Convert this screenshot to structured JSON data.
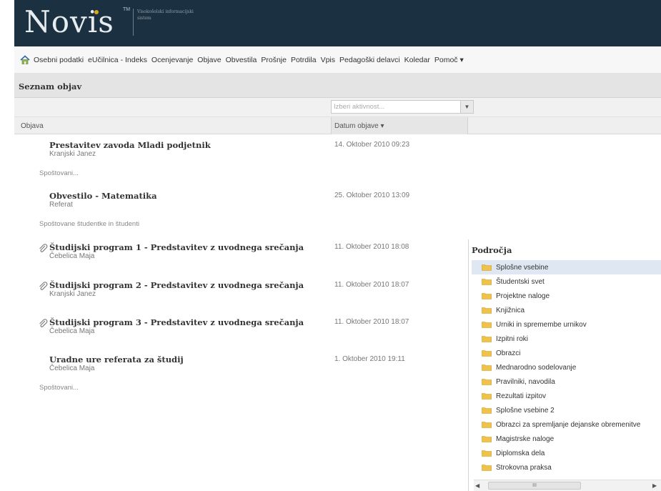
{
  "header": {
    "logo": "Novis",
    "tm": "TM",
    "subtitle": "Visokošolski informacijski sistem"
  },
  "nav": {
    "items": [
      "Osebni podatki",
      "eUčilnica - Indeks",
      "Ocenjevanje",
      "Objave",
      "Obvestila",
      "Prošnje",
      "Potrdila",
      "Vpis",
      "Pedagoški delavci",
      "Koledar",
      "Pomoč ▾"
    ]
  },
  "panel": {
    "title": "Seznam objav"
  },
  "filter": {
    "placeholder": "Izberi aktivnost..."
  },
  "grid": {
    "columns": {
      "objava": "Objava",
      "datum": "Datum objave ▾"
    },
    "rows": [
      {
        "title": "Prestavitev zavoda Mladi podjetnik",
        "author": "Kranjski Janez",
        "date": "14. Oktober 2010 09:23",
        "recipients": "Spoštovani...",
        "attachment": false
      },
      {
        "title": "Obvestilo - Matematika",
        "author": "Referat",
        "date": "25. Oktober 2010 13:09",
        "recipients": "Spoštovane študentke in študenti",
        "attachment": false
      },
      {
        "title": "Študijski program 1 - Predstavitev z uvodnega srečanja",
        "author": "Čebelica Maja",
        "date": "11. Oktober 2010 18:08",
        "recipients": "",
        "attachment": true
      },
      {
        "title": "Študijski program 2 - Predstavitev z uvodnega srečanja",
        "author": "Kranjski Janez",
        "date": "11. Oktober 2010 18:07",
        "recipients": "",
        "attachment": true
      },
      {
        "title": "Študijski program 3 - Predstavitev z uvodnega srečanja",
        "author": "Čebelica Maja",
        "date": "11. Oktober 2010 18:07",
        "recipients": "",
        "attachment": true
      },
      {
        "title": "Uradne ure referata za študij",
        "author": "Čebelica Maja",
        "date": "1. Oktober 2010 19:11",
        "recipients": "Spoštovani...",
        "attachment": false
      }
    ]
  },
  "areas": {
    "title": "Področja",
    "items": [
      "Splošne vsebine",
      "Študentski svet",
      "Projektne naloge",
      "Knjižnica",
      "Urniki in spremembe urnikov",
      "Izpitni roki",
      "Obrazci",
      "Mednarodno sodelovanje",
      "Pravilniki, navodila",
      "Rezultati izpitov",
      "Splošne vsebine 2",
      "Obrazci za spremljanje dejanske obremenitve",
      "Magistrske naloge",
      "Diplomska dela",
      "Strokovna praksa"
    ],
    "selected_index": 0
  },
  "scrollbar": {
    "thumb": "III"
  },
  "colors": {
    "header_bg": "#1b3142",
    "folder": "#f0c24a",
    "selected_row": "#dfe8f2"
  }
}
